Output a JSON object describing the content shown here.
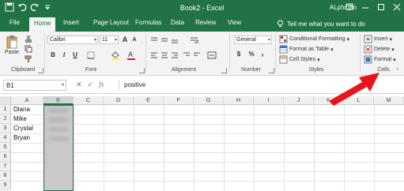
{
  "app": {
    "title": "Book2 - Excel",
    "user": "ALphr jan",
    "tell_me": "Tell me what you want to do"
  },
  "tabs": [
    "File",
    "Home",
    "Insert",
    "Page Layout",
    "Formulas",
    "Data",
    "Review",
    "View"
  ],
  "active_tab": "Home",
  "ribbon": {
    "clipboard": {
      "paste_label": "Paste",
      "group_label": "Clipboard"
    },
    "font": {
      "font_name": "Calibri",
      "font_size": "11",
      "group_label": "Font",
      "bold": "B",
      "italic": "I",
      "underline": "U",
      "grow": "A",
      "shrink": "A"
    },
    "alignment": {
      "group_label": "Alignment"
    },
    "number": {
      "format": "General",
      "currency": "$",
      "percent": "%",
      "comma": ",",
      "group_label": "Number"
    },
    "styles": {
      "conditional_formatting": "Conditional Formatting",
      "format_as_table": "Format as Table",
      "cell_styles": "Cell Styles",
      "group_label": "Styles"
    },
    "cells": {
      "insert": "Insert",
      "delete": "Delete",
      "format": "Format",
      "group_label": "Cells"
    }
  },
  "formula_bar": {
    "name_box": "B1",
    "cancel": "✕",
    "enter": "✓",
    "fx": "fx",
    "content": "positive"
  },
  "grid": {
    "columns": [
      "A",
      "B",
      "C",
      "D",
      "E",
      "F",
      "G",
      "H",
      "I",
      "J",
      "K",
      "L",
      "M"
    ],
    "rows": [
      "1",
      "2",
      "3",
      "4",
      "5",
      "6",
      "7",
      "8",
      "9"
    ],
    "column_a_values": [
      "Diana",
      "Mike",
      "Crystal",
      "Bryan"
    ]
  },
  "colors": {
    "excel_green": "#217346",
    "selection": "#c9c9c9",
    "arrow": "#e8141b"
  }
}
